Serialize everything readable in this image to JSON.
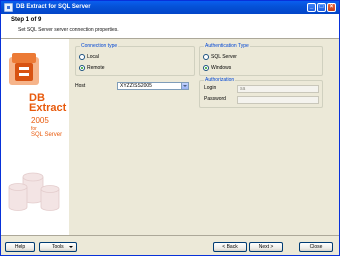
{
  "window": {
    "title": "DB Extract for SQL Server",
    "minimize_glyph": "_",
    "maximize_glyph": "□",
    "close_glyph": "×"
  },
  "step": {
    "title": "Step 1 of 9",
    "description": "Set SQL Server server connection properties."
  },
  "brand": {
    "name_line1": "DB",
    "name_line2": "Extract",
    "year": "2005",
    "for_text": "for",
    "target": "SQL Server",
    "accent_color": "#e85a0c"
  },
  "connection_type": {
    "title": "Connection type",
    "options": [
      {
        "label": "Local",
        "selected": false
      },
      {
        "label": "Remote",
        "selected": true
      }
    ]
  },
  "host": {
    "label": "Host",
    "value": "XYZZ\\SS2005"
  },
  "authentication_type": {
    "title": "Authentication Type",
    "options": [
      {
        "label": "SQL Server",
        "selected": false
      },
      {
        "label": "Windows",
        "selected": true
      }
    ]
  },
  "authorization": {
    "title": "Authorization",
    "login_label": "Login",
    "login_value": "sa",
    "password_label": "Password",
    "password_value": ""
  },
  "footer": {
    "help": "Help",
    "tools": "Tools",
    "back": "< Back",
    "next": "Next >",
    "close": "Close"
  }
}
